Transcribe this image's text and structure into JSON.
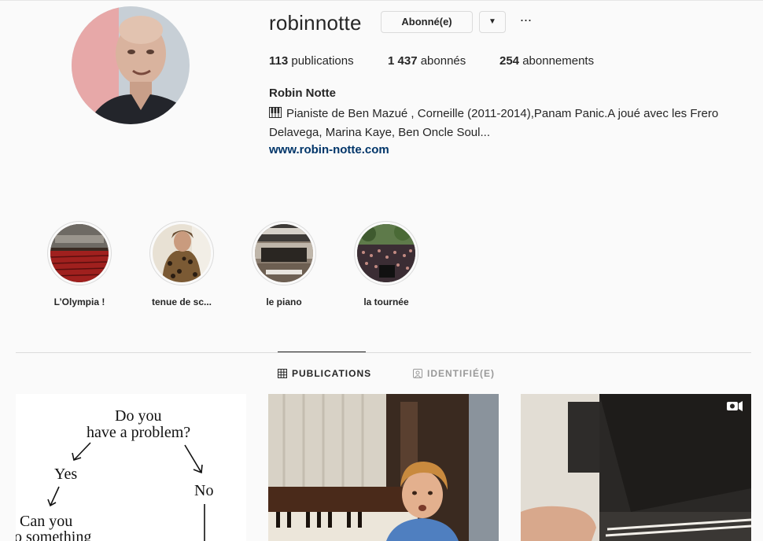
{
  "profile": {
    "username": "robinnotte",
    "follow_button": "Abonné(e)",
    "dropdown_glyph": "▼",
    "more_glyph": "···",
    "full_name": "Robin Notte",
    "bio_line1": "Pianiste de Ben Mazué , Corneille (2011-2014),Panam Panic.A joué avec les Frero",
    "bio_line2": "Delavega, Marina Kaye, Ben Oncle Soul...",
    "website": "www.robin-notte.com"
  },
  "stats": {
    "posts_count": "113",
    "posts_label": "publications",
    "followers_count": "1 437",
    "followers_label": "abonnés",
    "following_count": "254",
    "following_label": "abonnements"
  },
  "highlights": [
    {
      "label": "L’Olympia !"
    },
    {
      "label": "tenue de sc..."
    },
    {
      "label": "le piano"
    },
    {
      "label": "la tournée"
    }
  ],
  "tabs": {
    "publications": "PUBLICATIONS",
    "tagged": "IDENTIFIÉ(E)"
  },
  "posts": {
    "flowchart": {
      "q1": "Do you",
      "q2": "have a problem?",
      "yes": "Yes",
      "no": "No",
      "q3": "Can you",
      "q4": "o something"
    }
  },
  "colors": {
    "background": "#fafafa",
    "text": "#262626",
    "link": "#003569",
    "border": "#dbdbdb",
    "muted": "#999999"
  }
}
